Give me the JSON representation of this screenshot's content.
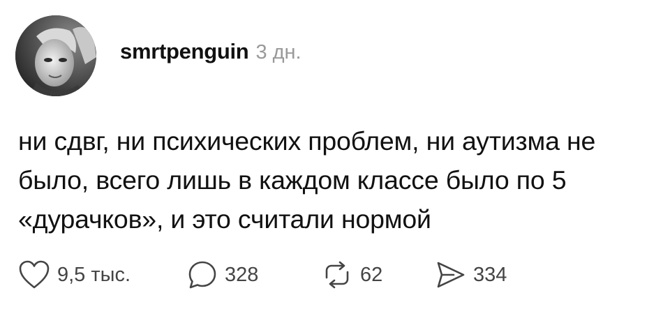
{
  "post": {
    "author": {
      "username": "smrtpenguin",
      "avatar_icon": "profile-photo"
    },
    "time_ago": "3 дн.",
    "text": "ни сдвг, ни психических проблем, ни аутизма не было, всего лишь в каждом классе было по 5 «дурачков», и это считали нормой",
    "actions": {
      "likes": {
        "icon": "heart-icon",
        "count": "9,5 тыс."
      },
      "comments": {
        "icon": "comment-icon",
        "count": "328"
      },
      "reposts": {
        "icon": "repost-icon",
        "count": "62"
      },
      "shares": {
        "icon": "send-icon",
        "count": "334"
      }
    }
  }
}
